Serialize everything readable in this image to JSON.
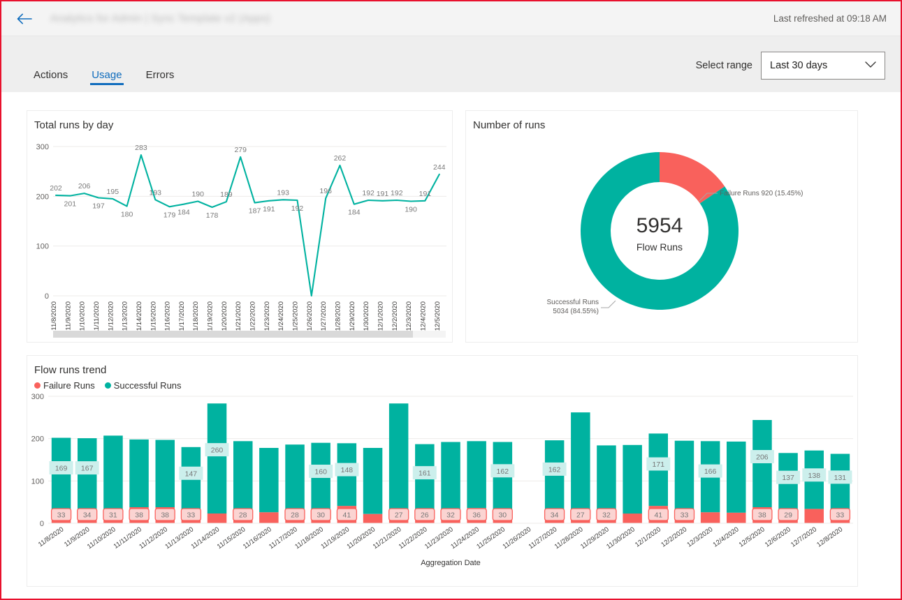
{
  "header": {
    "back_icon": "back-arrow-icon",
    "title": "Analytics for Admin | Sync Template v2 (Apps)",
    "refreshed": "Last refreshed at 09:18 AM"
  },
  "tabs": [
    {
      "label": "Actions",
      "active": false
    },
    {
      "label": "Usage",
      "active": true
    },
    {
      "label": "Errors",
      "active": false
    }
  ],
  "range": {
    "label": "Select range",
    "value": "Last 30 days",
    "chevron": "chevron-down-icon"
  },
  "colors": {
    "teal": "#00B2A0",
    "red": "#F9615C",
    "red_light": "#FBD4D2",
    "teal_light": "#CCEFEC",
    "accent": "#0f6cbd",
    "grid": "#EDEBE9"
  },
  "chart_data": [
    {
      "type": "line",
      "title": "Total runs by day",
      "xlabel": "",
      "ylabel": "",
      "ylim": [
        0,
        300
      ],
      "yticks": [
        0,
        100,
        200,
        300
      ],
      "grid": true,
      "series_color": "#00B2A0",
      "categories": [
        "11/8/2020",
        "11/9/2020",
        "11/10/2020",
        "11/11/2020",
        "11/12/2020",
        "11/13/2020",
        "11/14/2020",
        "11/15/2020",
        "11/16/2020",
        "11/17/2020",
        "11/18/2020",
        "11/19/2020",
        "11/20/2020",
        "11/21/2020",
        "11/22/2020",
        "11/23/2020",
        "11/24/2020",
        "11/25/2020",
        "11/26/2020",
        "11/27/2020",
        "11/28/2020",
        "11/29/2020",
        "11/30/2020",
        "12/1/2020",
        "12/2/2020",
        "12/3/2020",
        "12/4/2020",
        "12/5/2020"
      ],
      "values": [
        202,
        201,
        206,
        197,
        195,
        180,
        283,
        193,
        179,
        184,
        190,
        178,
        189,
        279,
        187,
        191,
        193,
        192,
        0,
        196,
        262,
        184,
        192,
        191,
        192,
        190,
        191,
        244
      ],
      "label_above": [
        true,
        false,
        true,
        false,
        true,
        false,
        true,
        true,
        false,
        false,
        true,
        false,
        true,
        true,
        false,
        false,
        true,
        false,
        false,
        true,
        true,
        false,
        true,
        true,
        true,
        false,
        true,
        true
      ]
    },
    {
      "type": "pie",
      "variant": "donut",
      "title": "Number of runs",
      "center_value": "5954",
      "center_label": "Flow Runs",
      "slices": [
        {
          "name": "Failure Runs",
          "value": 920,
          "percent": "15.45%",
          "color": "#F9615C",
          "label": "Failure Runs 920 (15.45%)"
        },
        {
          "name": "Successful Runs",
          "value": 5034,
          "percent": "84.55%",
          "color": "#00B2A0",
          "label_line1": "Successful Runs",
          "label_line2": "5034 (84.55%)"
        }
      ]
    },
    {
      "type": "bar",
      "variant": "stacked",
      "title": "Flow runs trend",
      "xlabel": "Aggregation Date",
      "ylabel": "",
      "ylim": [
        0,
        300
      ],
      "yticks": [
        0,
        100,
        200,
        300
      ],
      "grid": true,
      "legend": [
        {
          "name": "Failure Runs",
          "color": "#F9615C"
        },
        {
          "name": "Successful Runs",
          "color": "#00B2A0"
        }
      ],
      "categories": [
        "11/8/2020",
        "11/9/2020",
        "11/10/2020",
        "11/11/2020",
        "11/12/2020",
        "11/13/2020",
        "11/14/2020",
        "11/15/2020",
        "11/16/2020",
        "11/17/2020",
        "11/18/2020",
        "11/19/2020",
        "11/20/2020",
        "11/21/2020",
        "11/22/2020",
        "11/23/2020",
        "11/24/2020",
        "11/25/2020",
        "11/26/2020",
        "11/27/2020",
        "11/28/2020",
        "11/29/2020",
        "11/30/2020",
        "12/1/2020",
        "12/2/2020",
        "12/3/2020",
        "12/4/2020",
        "12/5/2020",
        "12/6/2020",
        "12/7/2020",
        "12/8/2020"
      ],
      "series": [
        {
          "name": "Failure Runs",
          "color": "#F9615C",
          "values": [
            33,
            34,
            31,
            38,
            38,
            33,
            23,
            28,
            26,
            28,
            30,
            41,
            22,
            27,
            26,
            32,
            36,
            30,
            0,
            34,
            27,
            32,
            23,
            41,
            33,
            26,
            25,
            38,
            29,
            34,
            33
          ],
          "shown_labels": [
            33,
            34,
            31,
            38,
            38,
            33,
            null,
            28,
            null,
            28,
            30,
            41,
            null,
            27,
            26,
            32,
            36,
            30,
            null,
            34,
            27,
            32,
            null,
            41,
            33,
            null,
            null,
            38,
            29,
            null,
            33
          ]
        },
        {
          "name": "Successful Runs",
          "color": "#00B2A0",
          "values": [
            169,
            167,
            176,
            160,
            159,
            147,
            260,
            166,
            152,
            158,
            160,
            148,
            156,
            256,
            161,
            160,
            158,
            162,
            0,
            162,
            235,
            152,
            162,
            171,
            162,
            168,
            168,
            206,
            137,
            138,
            131
          ],
          "shown_labels": [
            169,
            167,
            null,
            null,
            null,
            147,
            260,
            null,
            null,
            null,
            160,
            148,
            null,
            null,
            161,
            null,
            null,
            162,
            null,
            162,
            null,
            null,
            null,
            171,
            null,
            166,
            null,
            206,
            137,
            138,
            131
          ]
        }
      ],
      "totals": [
        202,
        201,
        207,
        198,
        197,
        180,
        283,
        194,
        178,
        186,
        190,
        189,
        178,
        283,
        187,
        192,
        194,
        192,
        0,
        196,
        262,
        184,
        185,
        194,
        195,
        194,
        193,
        244,
        166,
        162,
        164
      ]
    }
  ]
}
